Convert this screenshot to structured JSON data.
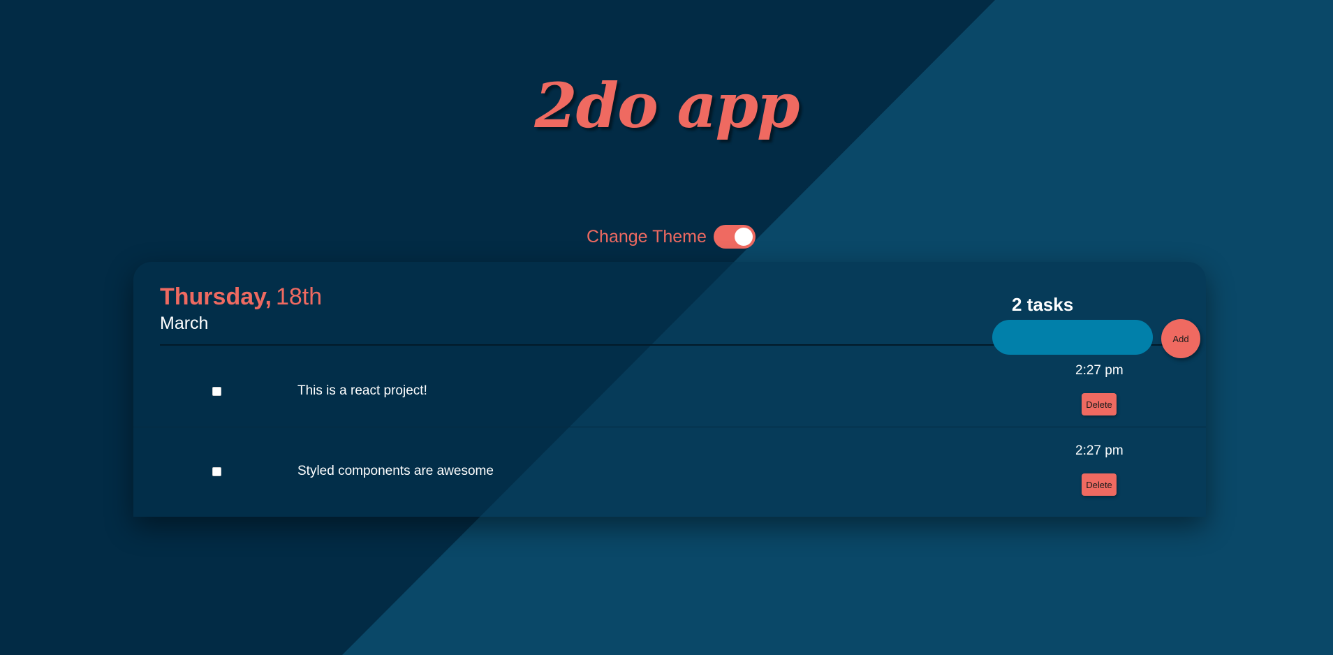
{
  "app": {
    "title": "2do app"
  },
  "theme": {
    "label": "Change Theme",
    "enabled": true
  },
  "header": {
    "weekday": "Thursday,",
    "day": "18th",
    "month": "March",
    "task_count": "2 tasks",
    "input": {
      "value": "",
      "placeholder": ""
    },
    "add_label": "Add"
  },
  "tasks": [
    {
      "text": "This is a react project!",
      "time": "2:27 pm",
      "done": false,
      "delete_label": "Delete"
    },
    {
      "text": "Styled components are awesome",
      "time": "2:27 pm",
      "done": false,
      "delete_label": "Delete"
    }
  ],
  "colors": {
    "accent": "#ef6a61",
    "background_dark": "#03304b",
    "background_light": "#0a4868",
    "input_fill": "#0180aa"
  }
}
